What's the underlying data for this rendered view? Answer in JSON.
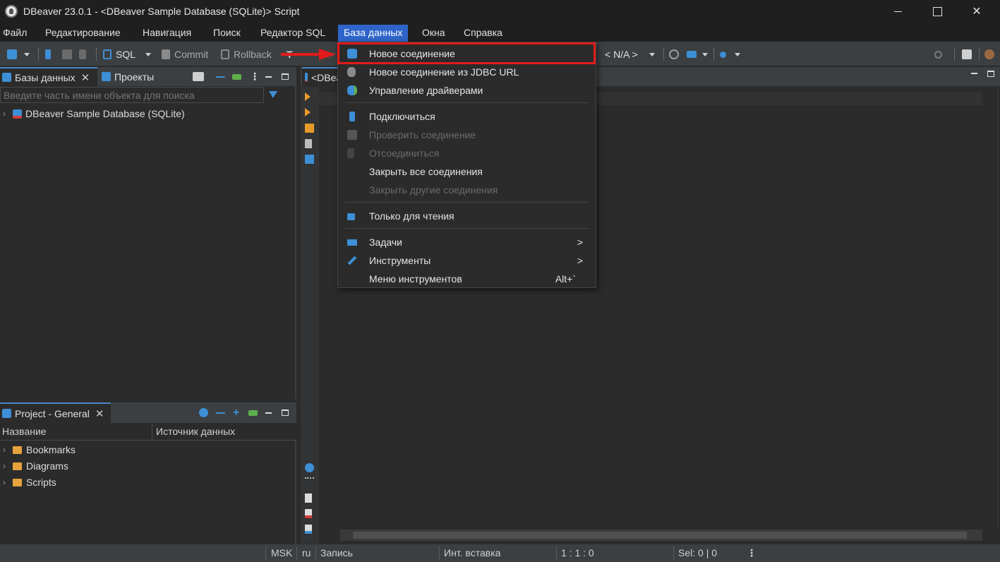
{
  "window": {
    "title": "DBeaver 23.0.1 - <DBeaver Sample Database (SQLite)> Script",
    "minimize_icon": "minimize-icon",
    "maximize_icon": "maximize-icon",
    "close_glyph": "✕"
  },
  "menu": [
    "Файл",
    "Редактирование",
    "Навигация",
    "Поиск",
    "Редактор SQL",
    "База данных",
    "Окна",
    "Справка"
  ],
  "menu_active": "База данных",
  "toolbar": {
    "sql_label": "SQL",
    "commit_label": "Commit",
    "rollback_label": "Rollback",
    "tx_label": "T",
    "schema_label": "< N/A >"
  },
  "db_panel": {
    "tab_databases": "Базы данных",
    "tab_projects": "Проекты",
    "search_placeholder": "Введите часть имени объекта для поиска",
    "tree": [
      {
        "label": "DBeaver Sample Database (SQLite)"
      }
    ]
  },
  "project_panel": {
    "tab_label": "Project - General",
    "col_name": "Название",
    "col_source": "Источник данных",
    "rows": [
      {
        "label": "Bookmarks"
      },
      {
        "label": "Diagrams"
      },
      {
        "label": "Scripts"
      }
    ]
  },
  "editor": {
    "tab_label": "<DBeaver Sample Database (SQLite)> Script"
  },
  "dropdown": {
    "items": [
      {
        "label": "Новое соединение",
        "icon": "plug-plus-icon",
        "disabled": false
      },
      {
        "label": "Новое соединение из JDBC URL",
        "icon": "database-icon",
        "disabled": false
      },
      {
        "label": "Управление драйверами",
        "icon": "drivers-icon",
        "disabled": false
      },
      {
        "label": "Подключиться",
        "icon": "plug-icon",
        "disabled": false
      },
      {
        "label": "Проверить соединение",
        "icon": "plug-check-icon",
        "disabled": true
      },
      {
        "label": "Отсоединиться",
        "icon": "unplug-icon",
        "disabled": true
      },
      {
        "label": "Закрыть все соединения",
        "icon": "",
        "disabled": false
      },
      {
        "label": "Закрыть другие соединения",
        "icon": "",
        "disabled": true
      },
      {
        "label": "Только для чтения",
        "icon": "lock-icon",
        "disabled": false
      },
      {
        "label": "Задачи",
        "icon": "tasks-icon",
        "disabled": false,
        "submenu": true
      },
      {
        "label": "Инструменты",
        "icon": "tools-icon",
        "disabled": false,
        "submenu": true
      },
      {
        "label": "Меню инструментов",
        "icon": "",
        "disabled": false,
        "shortcut": "Alt+`"
      }
    ]
  },
  "status": {
    "timezone": "MSK",
    "locale": "ru",
    "mode": "Запись",
    "insert_mode": "Инт. вставка",
    "position": "1 : 1 : 0",
    "selection": "Sel: 0 | 0"
  },
  "colors": {
    "accent": "#2f65ca",
    "highlight_red": "#e21b1b",
    "background": "#2b2b2b"
  }
}
